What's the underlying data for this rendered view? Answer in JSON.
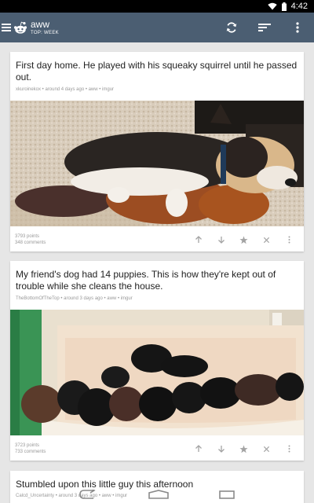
{
  "status_bar": {
    "time": "4:42"
  },
  "app_bar": {
    "title": "aww",
    "subtitle": "TOP: WEEK"
  },
  "posts": [
    {
      "title": "First day home. He played with his squeaky squirrel until he passed out.",
      "meta": "xkuroinekox • around 4 days ago • aww • imgur",
      "points": "3793 points",
      "comments": "348 comments"
    },
    {
      "title": "My friend's dog had 14 puppies. This is how they're kept out of trouble while she cleans the house.",
      "meta": "TheBottomOfTheTop • around 3 days ago • aww • imgur",
      "points": "3723 points",
      "comments": "733 comments"
    },
    {
      "title": "Stumbled upon this little guy this afternoon",
      "meta": "Calcd_Uncertainty • around 3 days ago • aww • imgur"
    }
  ],
  "colors": {
    "app_bar": "#4b5e72",
    "background": "#e6e6e6",
    "card": "#ffffff"
  }
}
